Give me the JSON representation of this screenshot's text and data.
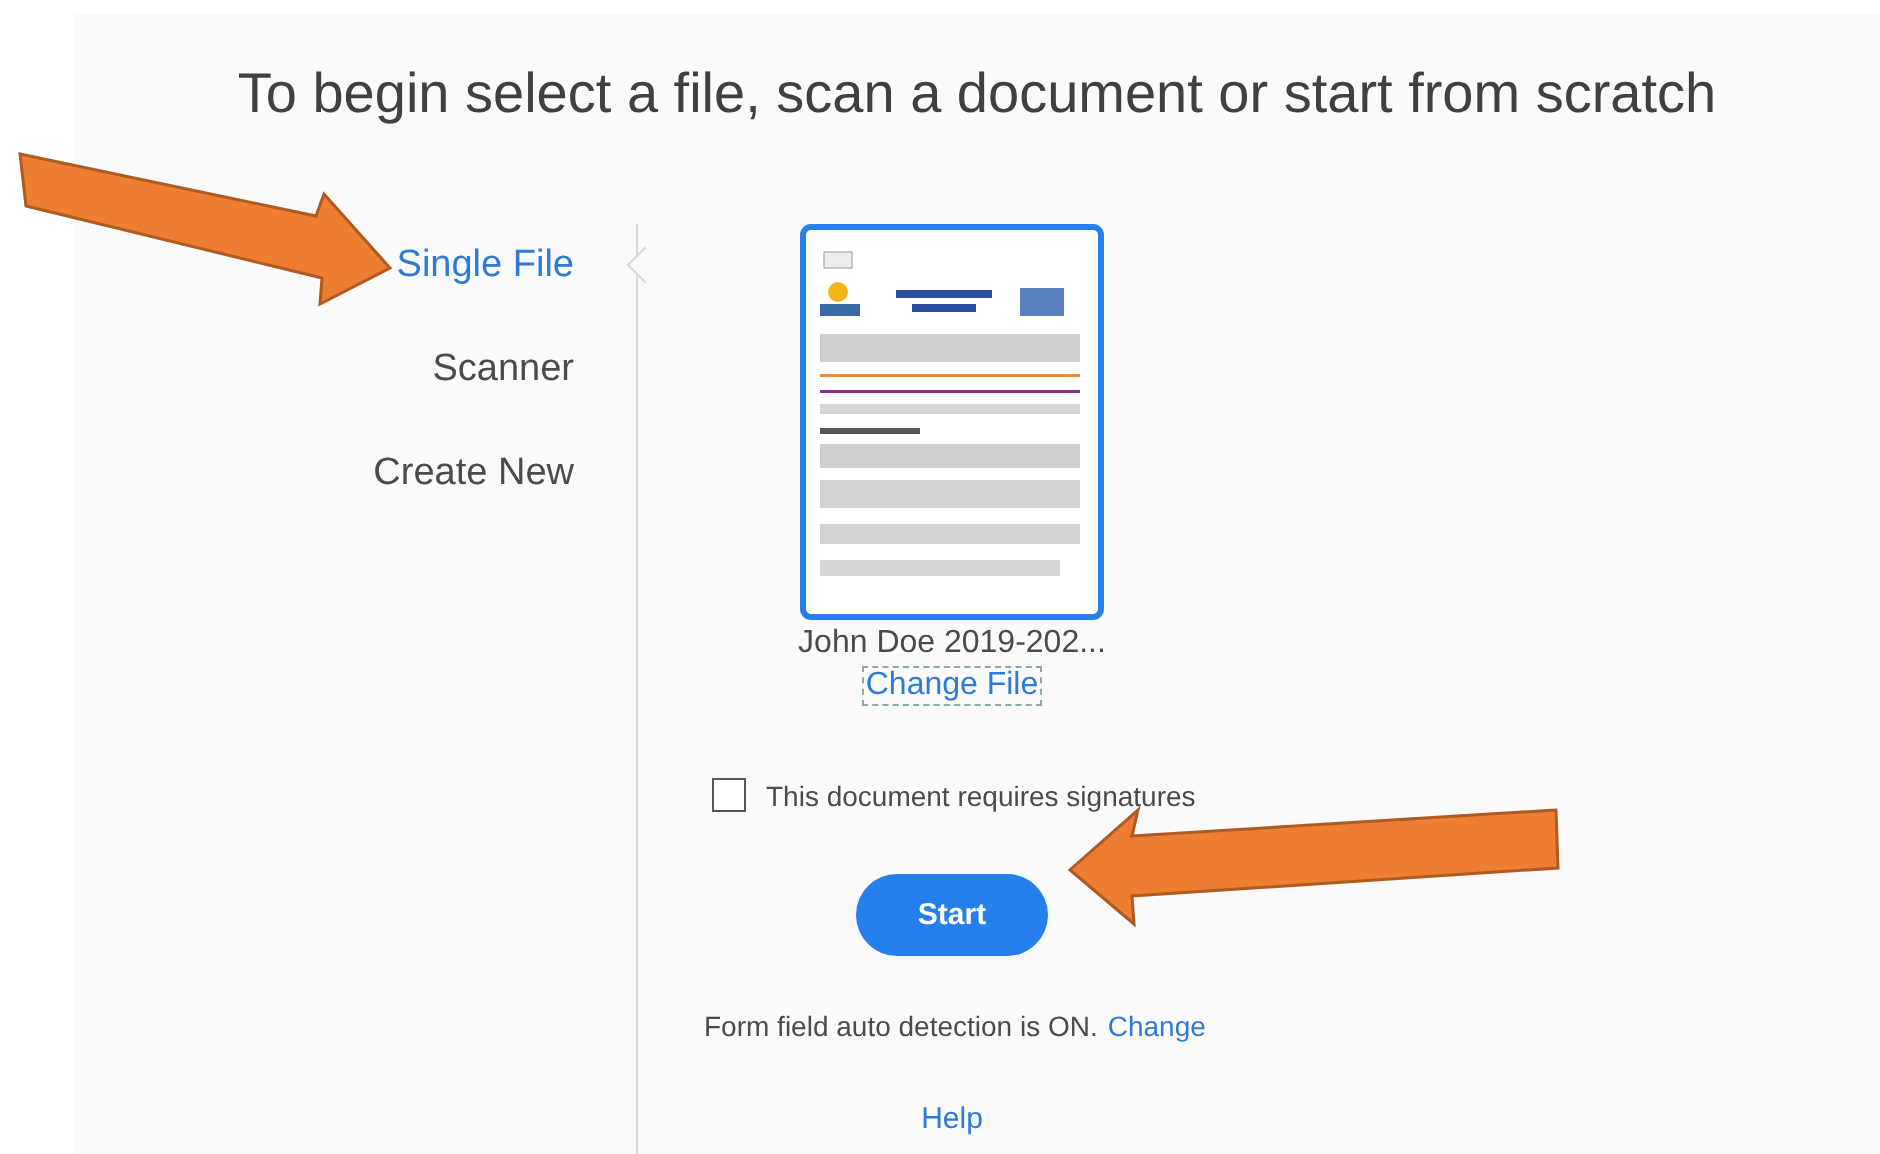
{
  "title": "To begin select a file, scan a document or start from scratch",
  "nav": [
    {
      "label": "Single File",
      "selected": true
    },
    {
      "label": "Scanner",
      "selected": false
    },
    {
      "label": "Create New",
      "selected": false
    }
  ],
  "file": {
    "name": "John Doe 2019-202...",
    "change_link": "Change File"
  },
  "signatures": {
    "label": "This document requires signatures",
    "checked": false
  },
  "start_button": "Start",
  "detection": {
    "text": "Form field auto detection is ON.",
    "link": "Change"
  },
  "help_link": "Help"
}
